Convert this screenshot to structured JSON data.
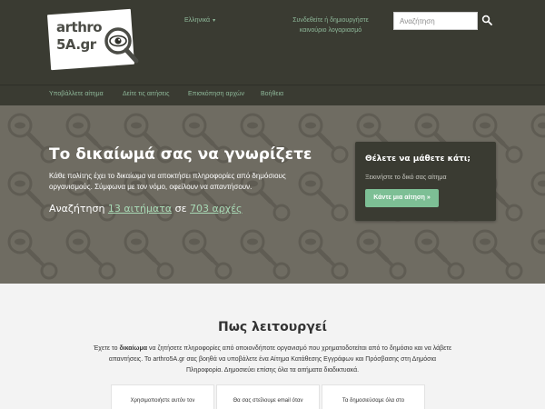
{
  "header": {
    "logo_line1": "arthro",
    "logo_line2": "5A.gr",
    "language": "Ελληνικά",
    "signin_line1": "Συνδεθείτε ή δημιουργήστε",
    "signin_line2": "καινούριο λογαριασμό",
    "search_placeholder": "Αναζήτηση"
  },
  "nav": {
    "items": [
      {
        "label": "Υποβάλλετε αίτημα"
      },
      {
        "label": "Δείτε τις αιτήσεις"
      },
      {
        "label": "Επισκόπηση αρχών"
      },
      {
        "label": "Βοήθεια"
      }
    ]
  },
  "hero": {
    "title": "Το δικαίωμά σας να γνωρίζετε",
    "text": "Κάθε πολίτης έχει το δικαίωμα να αποκτήσει πληροφορίες από δημόσιους οργανισμούς. Σύμφωνα με τον νόμο, οφείλουν να απαντήσουν.",
    "stats_prefix": "Αναζήτηση",
    "stats_requests": "13 αιτήματα",
    "stats_middle": "σε",
    "stats_authorities": "703 αρχές"
  },
  "cta": {
    "title": "Θέλετε να μάθετε κάτι;",
    "subtitle": "Ξεκινήστε το δικό σας αίτημα",
    "button": "Κάντε μια αίτηση »"
  },
  "how": {
    "title": "Πως λειτουργεί",
    "text_prefix": "Έχετε το ",
    "text_bold": "δικαίωμα",
    "text_rest": " να ζητήσετε πληροφορίες από οποιονδήποτε οργανισμό που χρηματοδοτείται από το δημόσιο και να λάβετε απαντήσεις. Το arthro5A.gr σας βοηθά να υποβάλετε ένα Αίτημα Κατάθεσης Εγγράφων και Πρόσβασης στη Δημόσια Πληροφορία. Δημοσιεύει επίσης όλα τα αιτήματα διαδικτυακά.",
    "cards": [
      {
        "text": "Χρησιμοποιήστε αυτόν τον"
      },
      {
        "text": "Θα σας στείλουμε email όταν"
      },
      {
        "text": "Τα δημοσιεύσαμε όλα στο"
      }
    ]
  },
  "colors": {
    "header_bg": "#3a3b32",
    "accent_green": "#7dbf95",
    "link_green": "#8fb99a",
    "hero_bg": "#6f6c62"
  },
  "icons": [
    "magnifier-eye-logo-icon",
    "search-icon",
    "chevron-down-icon"
  ]
}
